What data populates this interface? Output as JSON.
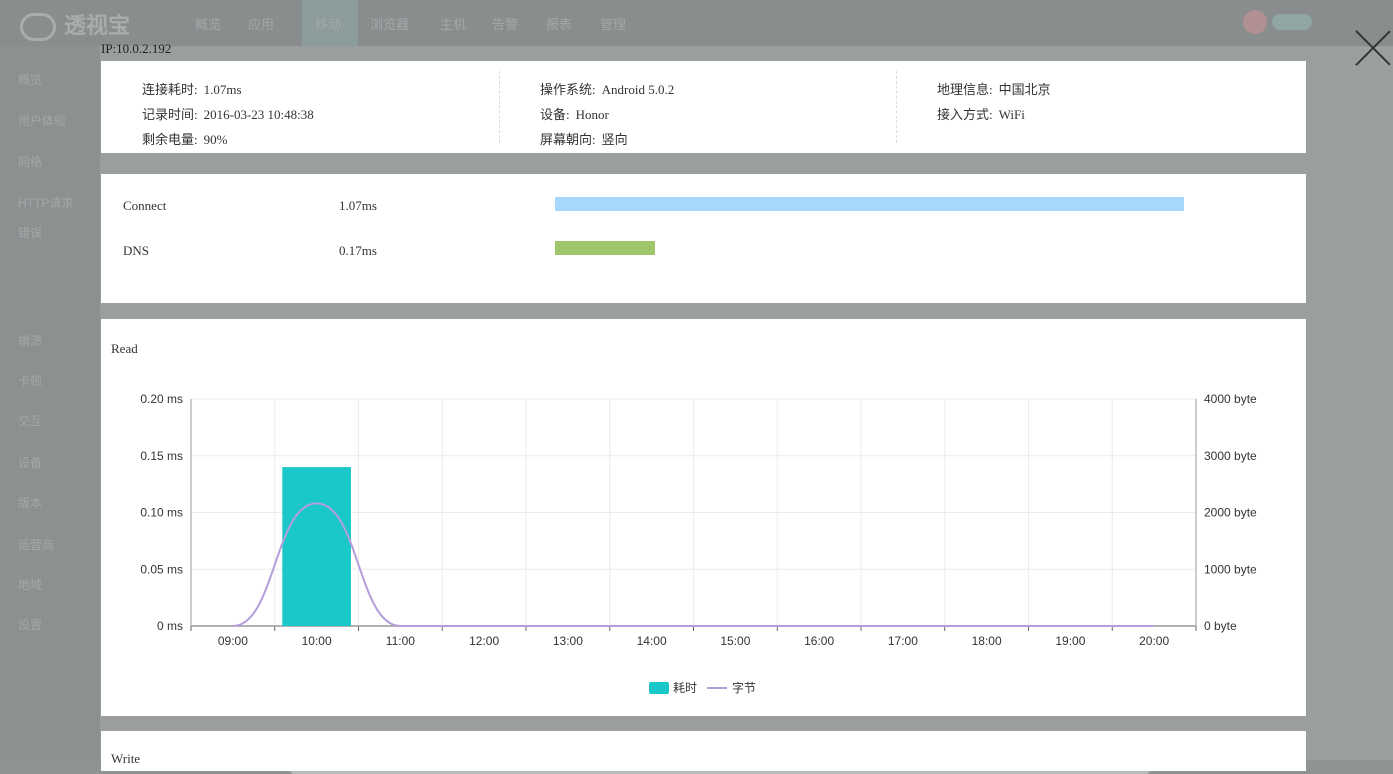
{
  "background": {
    "app_name": "透视宝",
    "nav": [
      "概览",
      "应用",
      "移动",
      "浏览器",
      "主机",
      "告警",
      "报表",
      "管理"
    ],
    "sidebar": [
      "概览",
      "用户体验",
      "网络",
      "HTTP请求",
      "错误",
      "崩溃",
      "卡顿",
      "交互",
      "设备",
      "版本",
      "运营商",
      "地域",
      "设置"
    ]
  },
  "ip_label": "IP:10.0.2.192",
  "info": {
    "col1": [
      {
        "label": "连接耗时:",
        "value": "1.07ms"
      },
      {
        "label": "记录时间:",
        "value": "2016-03-23 10:48:38"
      },
      {
        "label": "剩余电量:",
        "value": "90%"
      }
    ],
    "col2": [
      {
        "label": "操作系统:",
        "value": "Android 5.0.2"
      },
      {
        "label": "设备:",
        "value": "Honor"
      },
      {
        "label": "屏幕朝向:",
        "value": "竖向"
      }
    ],
    "col3": [
      {
        "label": "地理信息:",
        "value": "中国北京"
      },
      {
        "label": "接入方式:",
        "value": "WiFi"
      }
    ]
  },
  "timing": [
    {
      "name": "Connect",
      "value": "1.07ms",
      "ms": 1.07,
      "color": "#a8d8fb"
    },
    {
      "name": "DNS",
      "value": "0.17ms",
      "ms": 0.17,
      "color": "#a0c56a"
    }
  ],
  "read_title": "Read",
  "write_title": "Write",
  "chart_data": {
    "type": "bar",
    "title": "Read",
    "categories": [
      "09:00",
      "10:00",
      "11:00",
      "12:00",
      "13:00",
      "14:00",
      "15:00",
      "16:00",
      "17:00",
      "18:00",
      "19:00",
      "20:00"
    ],
    "series": [
      {
        "name": "耗时",
        "type": "bar",
        "axis": "left",
        "color": "#1ac8c9",
        "values": [
          0,
          0.14,
          0,
          0,
          0,
          0,
          0,
          0,
          0,
          0,
          0,
          0
        ]
      },
      {
        "name": "字节",
        "type": "line",
        "axis": "right",
        "color": "#b39ddb",
        "values": [
          0,
          2160,
          0,
          0,
          0,
          0,
          0,
          0,
          0,
          0,
          0,
          0
        ]
      }
    ],
    "y_left": {
      "ticks": [
        "0 ms",
        "0.05 ms",
        "0.10 ms",
        "0.15 ms",
        "0.20 ms"
      ],
      "ylim": [
        0,
        0.2
      ]
    },
    "y_right": {
      "ticks": [
        "0 byte",
        "1000 byte",
        "2000 byte",
        "3000 byte",
        "4000 byte"
      ],
      "ylim": [
        0,
        4000
      ]
    },
    "grid": true,
    "legend": "bottom-center"
  },
  "colors": {
    "accent": "#1ac8c9",
    "line": "#b39ddb"
  }
}
